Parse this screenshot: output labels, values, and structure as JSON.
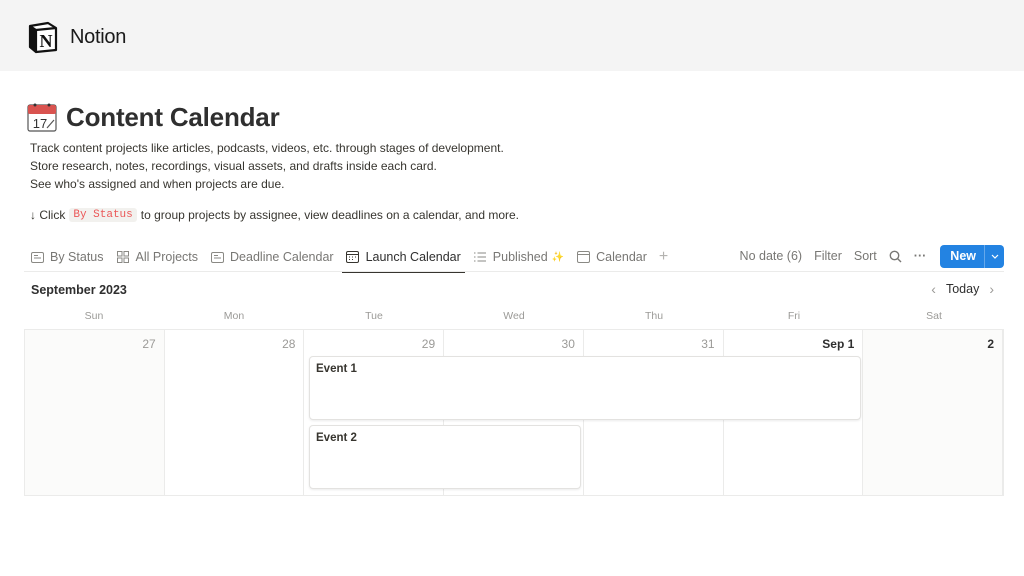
{
  "brand": {
    "name": "Notion"
  },
  "page": {
    "icon": "calendar-emoji-icon",
    "title": "Content Calendar",
    "description": [
      "Track content projects like articles, podcasts, videos, etc. through stages of development.",
      "Store research, notes, recordings, visual assets, and drafts inside each card.",
      "See who's assigned and when projects are due."
    ],
    "hint": {
      "prefix": "↓ Click",
      "code": "By Status",
      "suffix": "to group projects by assignee, view deadlines on a calendar, and more."
    }
  },
  "tabs": [
    {
      "label": "By Status",
      "icon": "board-icon",
      "active": false
    },
    {
      "label": "All Projects",
      "icon": "gallery-icon",
      "active": false
    },
    {
      "label": "Deadline Calendar",
      "icon": "board-icon",
      "active": false
    },
    {
      "label": "Launch Calendar",
      "icon": "calendar-icon",
      "active": true
    },
    {
      "label": "Published",
      "icon": "list-icon",
      "active": false,
      "badge": "✨"
    },
    {
      "label": "Calendar",
      "icon": "calendar-icon",
      "active": false
    }
  ],
  "toolbar": {
    "no_date": "No date (6)",
    "filter": "Filter",
    "sort": "Sort",
    "more": "···",
    "new": "New",
    "new_caret": "⌄"
  },
  "calendar": {
    "month": "September 2023",
    "today_label": "Today",
    "prev": "‹",
    "next": "›",
    "weekdays": [
      "Sun",
      "Mon",
      "Tue",
      "Wed",
      "Thu",
      "Fri",
      "Sat"
    ],
    "days": [
      "27",
      "28",
      "29",
      "30",
      "31",
      "Sep 1",
      "2"
    ],
    "events": [
      {
        "title": "Event 1",
        "start_day_index": 2,
        "end_day_index": 5
      },
      {
        "title": "Event 2",
        "start_day_index": 2,
        "end_day_index": 3
      }
    ]
  },
  "colors": {
    "accent": "#2383e2",
    "code_text": "#eb5757"
  }
}
